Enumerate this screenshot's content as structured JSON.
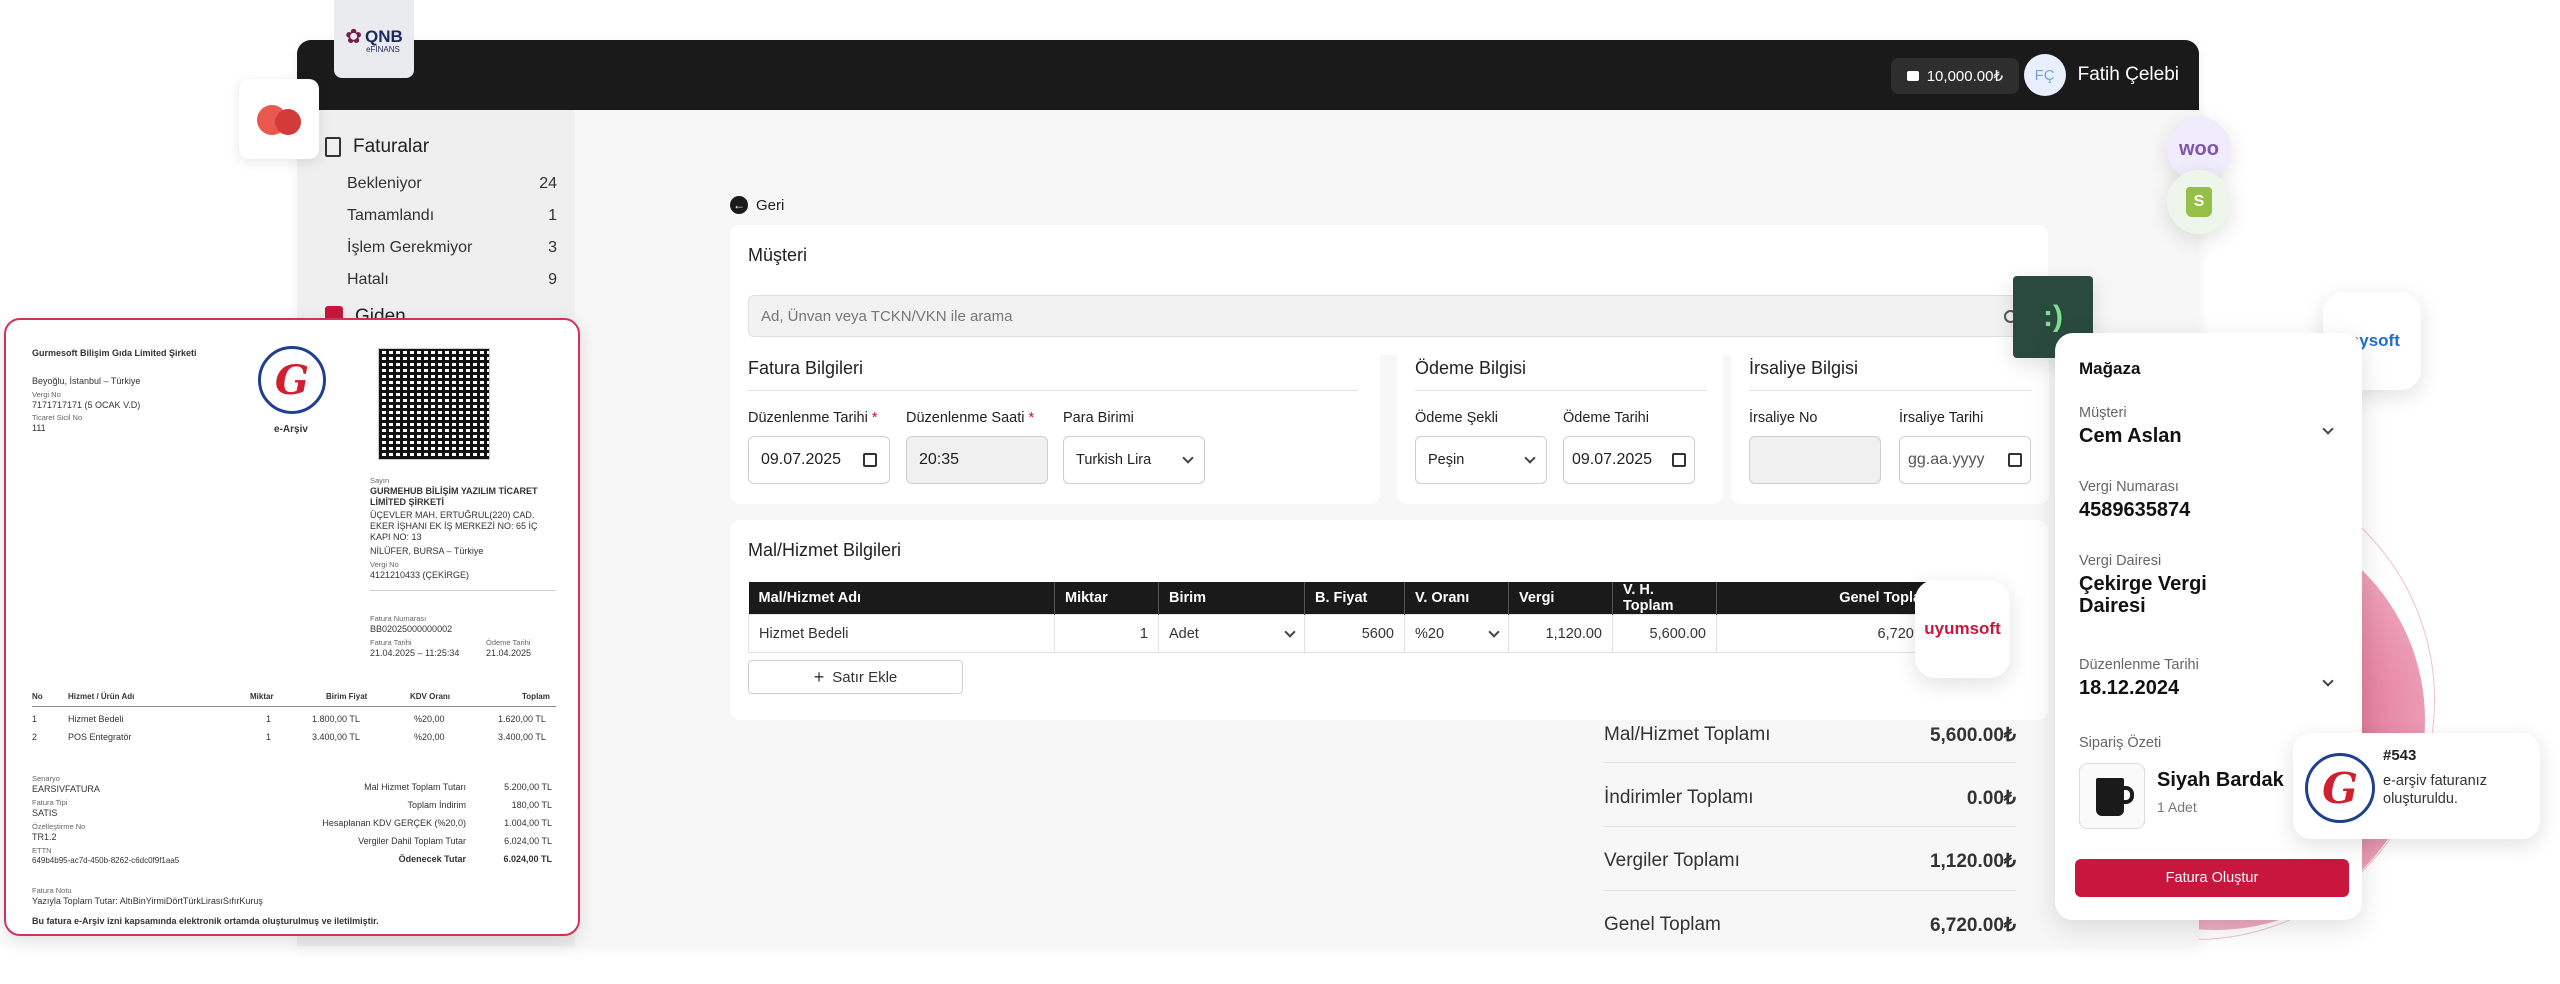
{
  "brand": {
    "logo_line1": "QNB",
    "logo_line2": "eFİNANS",
    "accent": "#c8163d",
    "dark": "#1a1a1a"
  },
  "topbar": {
    "balance": "10,000.00₺",
    "avatar_initials": "FÇ",
    "user_name": "Fatih Çelebi"
  },
  "sidebar": {
    "title": "Faturalar",
    "items": [
      {
        "label": "Bekleniyor",
        "count": "24"
      },
      {
        "label": "Tamamlandı",
        "count": "1"
      },
      {
        "label": "İşlem Gerekmiyor",
        "count": "3"
      },
      {
        "label": "Hatalı",
        "count": "9"
      }
    ],
    "next_item": "Giden"
  },
  "back": {
    "label": "Geri"
  },
  "customer": {
    "title": "Müşteri",
    "search_placeholder": "Ad, Ünvan veya TCKN/VKN ile arama"
  },
  "invoice_info": {
    "title": "Fatura Bilgileri",
    "date_label": "Düzenlenme Tarihi",
    "date_value": "09.07.2025",
    "time_label": "Düzenlenme Saati",
    "time_value": "20:35",
    "currency_label": "Para Birimi",
    "currency_value": "Turkish Lira",
    "required": "*"
  },
  "payment_info": {
    "title": "Ödeme Bilgisi",
    "method_label": "Ödeme Şekli",
    "method_value": "Peşin",
    "date_label": "Ödeme Tarihi",
    "date_value": "09.07.2025"
  },
  "waybill_info": {
    "title": "İrsaliye Bilgisi",
    "no_label": "İrsaliye No",
    "no_value": "",
    "date_label": "İrsaliye Tarihi",
    "date_placeholder": "gg.aa.yyyy"
  },
  "goods": {
    "title": "Mal/Hizmet Bilgileri",
    "columns": [
      "Mal/Hizmet Adı",
      "Miktar",
      "Birim",
      "B. Fiyat",
      "V. Oranı",
      "Vergi",
      "V. H. Toplam",
      "Genel Toplam"
    ],
    "row": {
      "name": "Hizmet Bedeli",
      "qty": "1",
      "unit": "Adet",
      "price": "5600",
      "rate": "%20",
      "tax": "1,120.00",
      "subtotal": "5,600.00",
      "total": "6,720.00"
    },
    "add_row": "Satır Ekle"
  },
  "totals": [
    {
      "label": "Mal/Hizmet Toplamı",
      "value": "5,600.00₺"
    },
    {
      "label": "İndirimler Toplamı",
      "value": "0.00₺"
    },
    {
      "label": "Vergiler Toplamı",
      "value": "1,120.00₺"
    },
    {
      "label": "Genel Toplam",
      "value": "6,720.00₺"
    }
  ],
  "invoice_preview": {
    "company": "Gurmesoft Bilişim Gıda Limited Şirketi",
    "location": "Beyoğlu, İstanbul – Türkiye",
    "tax_no_label": "Vergi No",
    "tax_no": "7171717171 (5 OCAK V.D)",
    "trade_reg_label": "Ticaret Sicil No",
    "trade_reg": "111",
    "earsiv_label": "e-Arşiv",
    "buyer_label": "Sayın",
    "buyer_name1": "GURMEHUB BİLİŞİM YAZILIM TİCARET",
    "buyer_name2": "LİMİTED ŞİRKETİ",
    "buyer_addr1": "ÜÇEVLER MAH. ERTUĞRUL(220) CAD.",
    "buyer_addr2": "EKER İŞHANI EK İŞ MERKEZİ NO: 65 İÇ",
    "buyer_addr3": "KAPI NO: 13",
    "buyer_city": "NİLÜFER, BURSA – Türkiye",
    "buyer_tax_label": "Vergi No",
    "buyer_tax": "4121210433 (ÇEKİRGE)",
    "inv_no_label": "Fatura Numarası",
    "inv_no": "BB02025000000002",
    "inv_date_label": "Fatura Tarihi",
    "inv_date": "21.04.2025 – 11:25:34",
    "pay_date_label": "Ödeme Tarihi",
    "pay_date": "21.04.2025",
    "table_headers": [
      "No",
      "Hizmet / Ürün Adı",
      "Miktar",
      "Birim Fiyat",
      "KDV Oranı",
      "Toplam"
    ],
    "rows": [
      [
        "1",
        "Hizmet Bedeli",
        "1",
        "1.800,00 TL",
        "%20,00",
        "1.620,00 TL"
      ],
      [
        "2",
        "POS Entegratör",
        "1",
        "3.400,00 TL",
        "%20,00",
        "3.400,00 TL"
      ]
    ],
    "scenario_label": "Senaryo",
    "scenario": "EARSIVFATURA",
    "type_label": "Fatura Tipi",
    "type": "SATIS",
    "custom_label": "Özelleştirme No",
    "custom": "TR1.2",
    "ettn_label": "ETTN",
    "ettn": "649b4b95-ac7d-450b-8262-c6dc0f9f1aa5",
    "sums": [
      {
        "label": "Mal Hizmet Toplam Tutarı",
        "value": "5.200,00 TL"
      },
      {
        "label": "Toplam İndirim",
        "value": "180,00 TL"
      },
      {
        "label": "Hesaplanan KDV GERÇEK (%20,0)",
        "value": "1.004,00 TL"
      },
      {
        "label": "Vergiler Dahil Toplam Tutar",
        "value": "6.024,00 TL"
      },
      {
        "label": "Ödenecek Tutar",
        "value": "6.024,00 TL"
      }
    ],
    "note_label": "Fatura Notu",
    "note": "Yazıyla Toplam Tutar: AltıBinYirmiDörtTürkLirasıSıfırKuruş",
    "footer": "Bu fatura e-Arşiv izni kapsamında elektronik ortamda oluşturulmuş ve iletilmiştir."
  },
  "store_card": {
    "title": "Mağaza",
    "customer_label": "Müşteri",
    "customer_value": "Cem Aslan",
    "tax_no_label": "Vergi Numarası",
    "tax_no_value": "4589635874",
    "tax_office_label": "Vergi Dairesi",
    "tax_office_line1": "Çekirge Vergi",
    "tax_office_line2": "Dairesi",
    "date_label": "Düzenlenme Tarihi",
    "date_value": "18.12.2024",
    "order_label": "Sipariş Özeti",
    "product_name": "Siyah Bardak",
    "product_qty": "1 Adet",
    "cta": "Fatura Oluştur"
  },
  "integrations": {
    "woo": "woo",
    "uyumsoft": "uyumsoft",
    "mysoft": "mysoft"
  },
  "notification": {
    "number": "#543",
    "line1": "e-arşiv faturanız",
    "line2": "oluşturuldu."
  }
}
